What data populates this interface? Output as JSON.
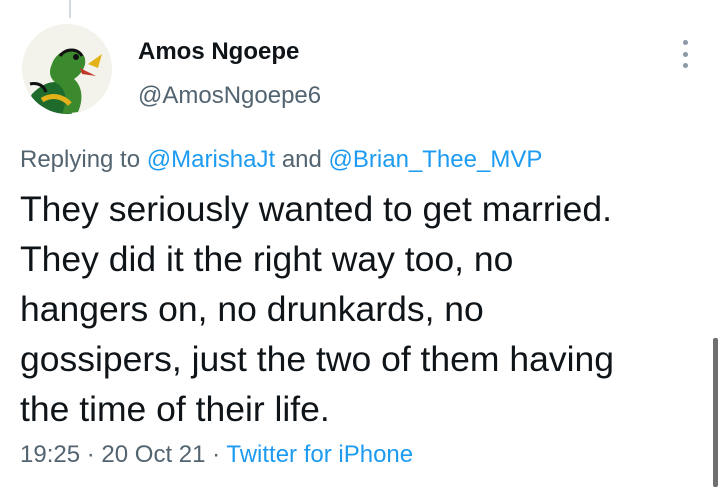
{
  "tweet": {
    "author": {
      "display_name": "Amos Ngoepe",
      "handle": "@AmosNgoepe6"
    },
    "reply_context": {
      "prefix": "Replying to",
      "mentions": [
        "@MarishaJt",
        "@Brian_Thee_MVP"
      ],
      "conjunction": "and"
    },
    "text_lines": [
      "They seriously wanted to get married.",
      "They did it the right way too, no",
      "hangers on, no drunkards, no",
      "gossipers, just the two of them having",
      "the time of their life."
    ],
    "meta": {
      "time": "19:25",
      "date": "20 Oct 21",
      "separator": "·",
      "source": "Twitter for iPhone"
    }
  },
  "icons": {
    "more": "more-vertical-icon",
    "avatar": "avatar"
  },
  "colors": {
    "text": "#0f1419",
    "secondary": "#536471",
    "link": "#1d9bf0",
    "background": "#ffffff"
  }
}
